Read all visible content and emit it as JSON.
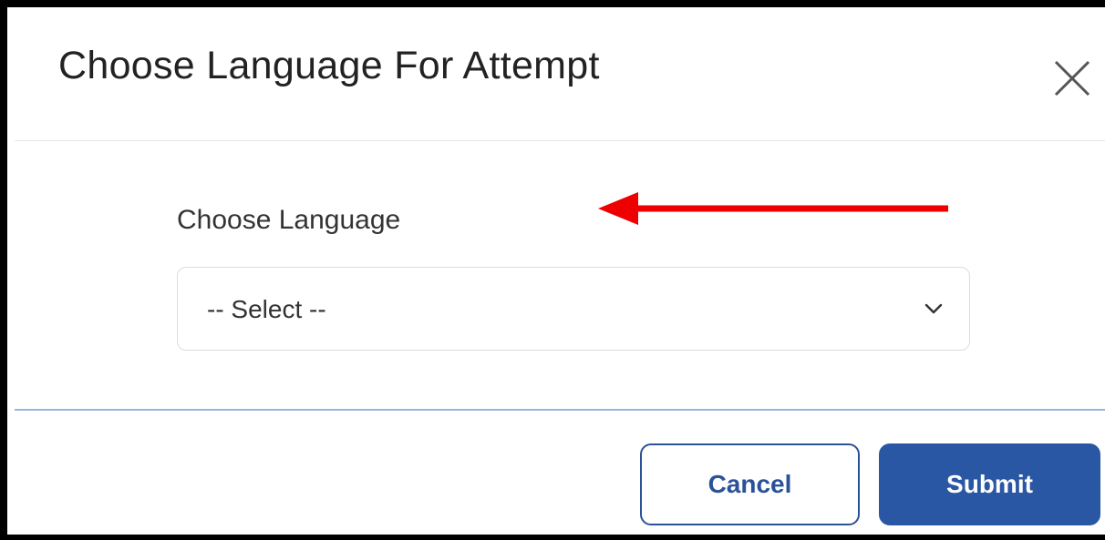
{
  "modal": {
    "title": "Choose Language For Attempt",
    "close_icon": "close-icon"
  },
  "form": {
    "language_label": "Choose Language",
    "language_select": {
      "selected": "-- Select --",
      "icon": "chevron-down-icon"
    }
  },
  "annotation": {
    "arrow_color": "#ee0000",
    "arrow_icon": "arrow-left-icon"
  },
  "footer": {
    "cancel_label": "Cancel",
    "submit_label": "Submit"
  },
  "colors": {
    "primary": "#2a57a3",
    "divider": "#9bb5db",
    "text": "#222222"
  }
}
